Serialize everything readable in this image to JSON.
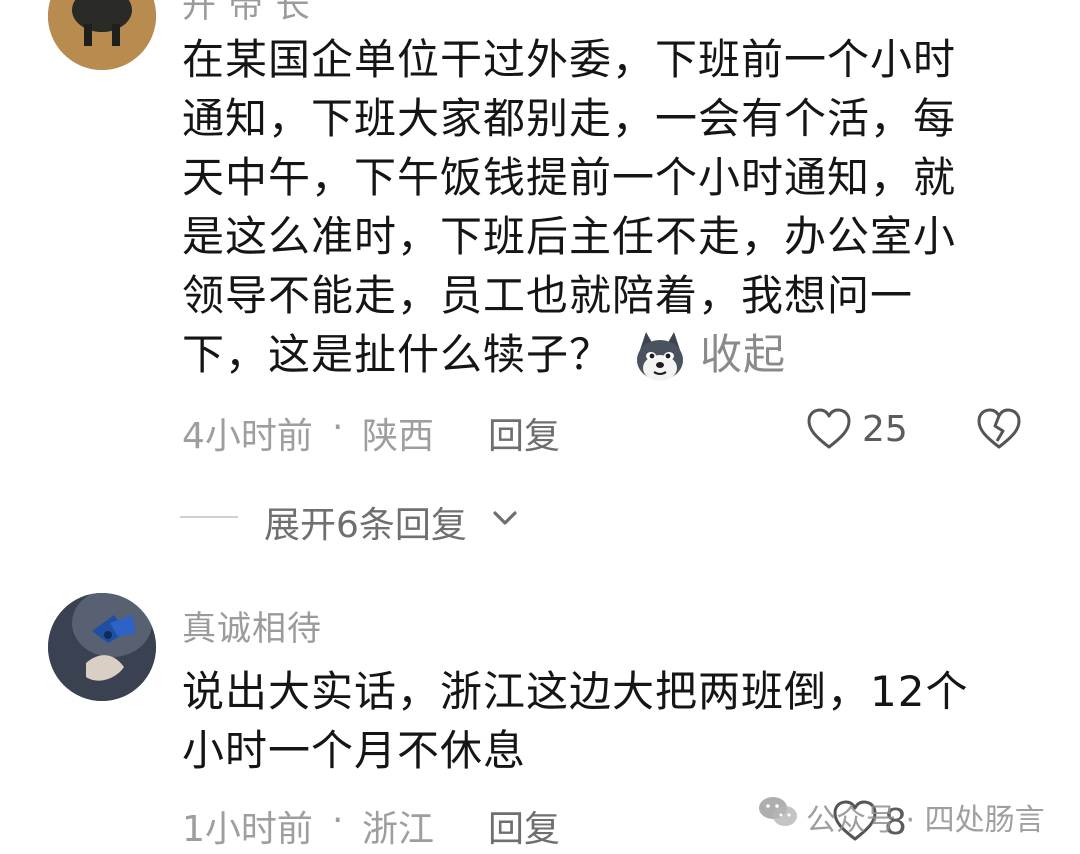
{
  "comments": [
    {
      "username": "开 帝 长",
      "lines": [
        "在某国企单位干过外委，下班前一个小时",
        "通知，下班大家都别走，一会有个活，每",
        "天中午，下午饭钱提前一个小时通知，就",
        "是这么准时，下班后主任不走，办公室小",
        "领导不能走，员工也就陪着，我想问一",
        "下，这是扯什么犊子？"
      ],
      "collapse_label": "收起",
      "time": "4小时前",
      "dot": "·",
      "location": "陕西",
      "reply_label": "回复",
      "like_count": "25",
      "expand_label": "展开6条回复"
    },
    {
      "username": "真诚相待",
      "lines": [
        "说出大实话，浙江这边大把两班倒，12个",
        "小时一个月不休息"
      ],
      "time": "1小时前",
      "dot": "·",
      "location": "浙江",
      "reply_label": "回复",
      "like_count": "8"
    }
  ],
  "watermark": {
    "text": "公众号 · 四处肠言"
  },
  "icons": {
    "like": "heart-outline-icon",
    "dislike": "broken-heart-icon",
    "expand": "chevron-down-icon",
    "emoji": "husky-dog-emoji-icon",
    "watermark": "wechat-logo-icon"
  }
}
